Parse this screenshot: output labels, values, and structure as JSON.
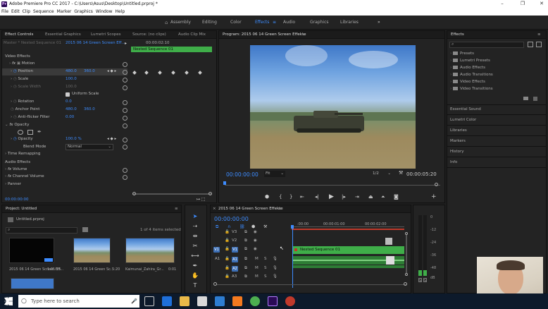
{
  "window": {
    "title": "Adobe Premiere Pro CC 2017 - C:\\Users\\Asus\\Desktop\\Untitled.prproj *",
    "app_icon": "Pr"
  },
  "menu": [
    "File",
    "Edit",
    "Clip",
    "Sequence",
    "Marker",
    "Graphics",
    "Window",
    "Help"
  ],
  "workspaces": {
    "items": [
      "Assembly",
      "Editing",
      "Color",
      "Effects",
      "Audio",
      "Graphics",
      "Libraries"
    ],
    "active": "Effects",
    "more": "»"
  },
  "effect_controls": {
    "tabs": [
      "Effect Controls",
      "Essential Graphics",
      "Lumetri Scopes",
      "Source: (no clips)",
      "Audio Clip Mix"
    ],
    "master": "Master * Nested Sequence 01",
    "sequence": "2015 06 14 Green Screen Eff...",
    "timecode_ruler": "00:00:02:10",
    "clip_label": "Nested Sequence 01",
    "video_effects_header": "Video Effects",
    "motion": "Motion",
    "position_label": "Position",
    "position_x": "480.0",
    "position_y": "360.0",
    "scale_label": "Scale",
    "scale_value": "100.0",
    "scale_width_label": "Scale Width",
    "scale_width_value": "100.0",
    "uniform_scale": "Uniform Scale",
    "rotation_label": "Rotation",
    "rotation_value": "0.0",
    "anchor_label": "Anchor Point",
    "anchor_x": "480.0",
    "anchor_y": "360.0",
    "antiflicker_label": "Anti-flicker Filter",
    "antiflicker_value": "0.00",
    "opacity_header": "Opacity",
    "opacity_label": "Opacity",
    "opacity_value": "100.0 %",
    "blend_label": "Blend Mode",
    "blend_value": "Normal",
    "time_remap": "Time Remapping",
    "audio_effects_header": "Audio Effects",
    "volume": "Volume",
    "channel_volume": "Channel Volume",
    "panner": "Panner",
    "current_time": "00:00:00:00"
  },
  "program": {
    "title": "Program: 2015 06 14 Green Screen Effekte",
    "timecode": "00:00:00:00",
    "fit": "Fit",
    "resolution": "1/2",
    "duration": "00:00:05:20"
  },
  "effects_panel": {
    "title": "Effects",
    "folders": [
      "Presets",
      "Lumetri Presets",
      "Audio Effects",
      "Audio Transitions",
      "Video Effects",
      "Video Transitions"
    ],
    "sections": [
      "Essential Sound",
      "Lumetri Color",
      "Libraries",
      "Markers",
      "History",
      "Info"
    ]
  },
  "project": {
    "title": "Project: Untitled",
    "file": "Untitled.prproj",
    "selection": "1 of 4 items selected",
    "items": [
      {
        "name": "2015 06 14 Green Screen Eff...",
        "duration": "1:01:15"
      },
      {
        "name": "2015 06 14 Green Sc...",
        "duration": "5:20"
      },
      {
        "name": "Kaimunai_Zahira_Gr...",
        "duration": "0:01"
      }
    ]
  },
  "timeline": {
    "title": "2015 06 14 Green Screen Effekte",
    "timecode": "00:00:00:00",
    "ruler": [
      ":00:00",
      "00:00:01:00",
      "00:00:02:00"
    ],
    "tracks": [
      "V3",
      "V2",
      "V1",
      "A1",
      "A2",
      "A3"
    ],
    "source_v": "V1",
    "source_a": "A1",
    "clip": "Nested Sequence 01"
  },
  "meter": {
    "labels": [
      "0",
      "-12",
      "-24",
      "-36",
      "-48",
      "dB"
    ],
    "solo": [
      "S",
      "S"
    ]
  },
  "taskbar": {
    "search_placeholder": "Type here to search"
  },
  "colors": {
    "accent": "#3d8cff",
    "clip_green": "#3fae49",
    "panel_bg": "#232323"
  }
}
